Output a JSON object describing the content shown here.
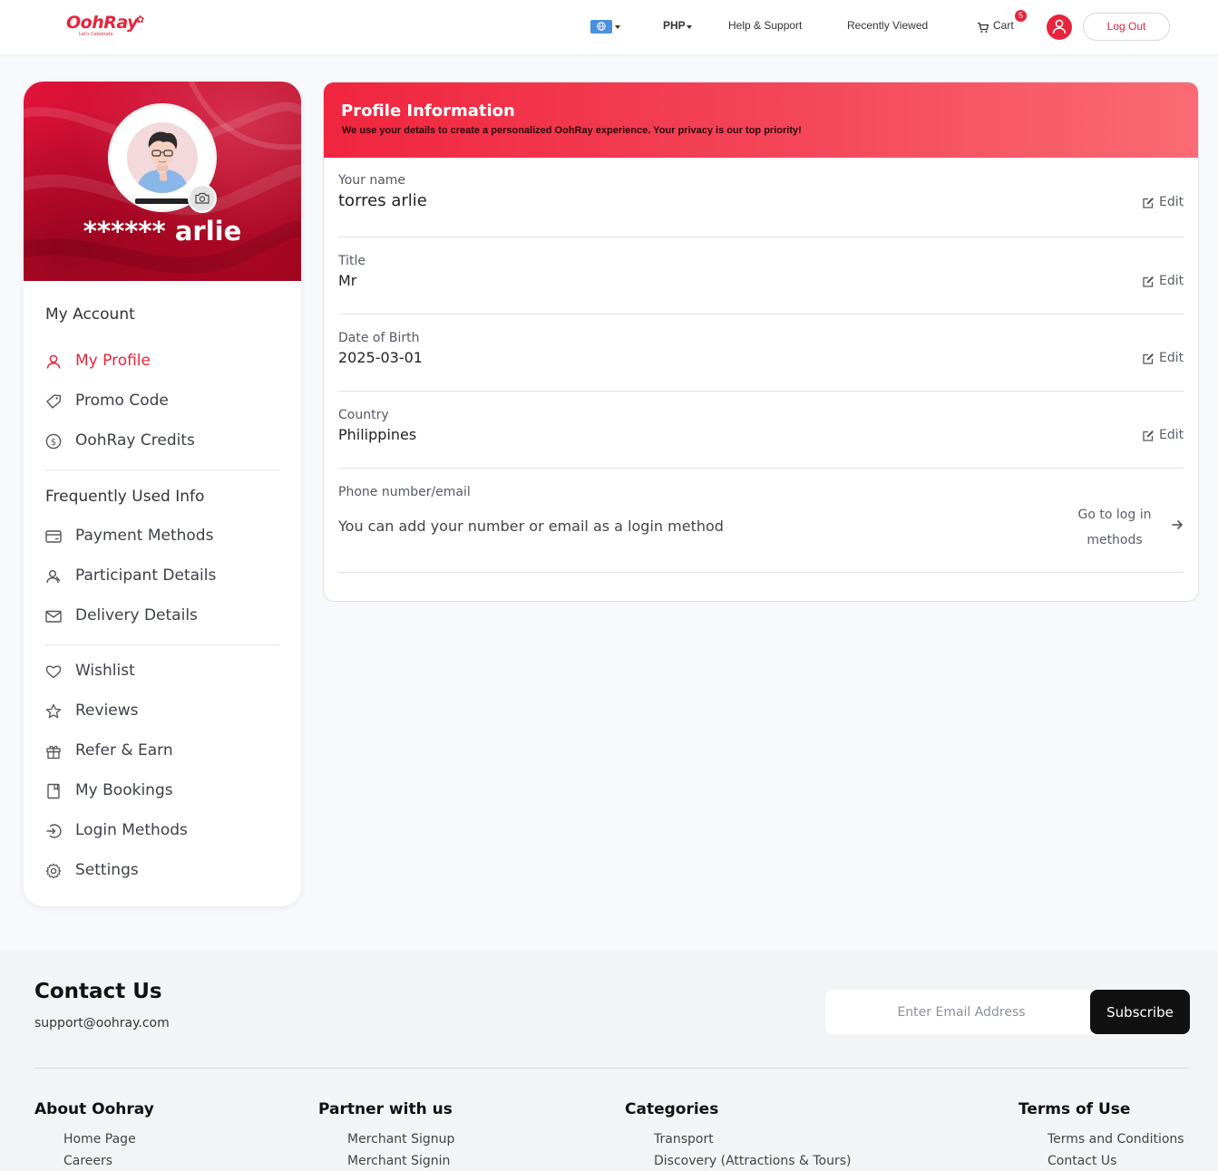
{
  "header": {
    "logo_text": "OohRay",
    "logo_tagline": "Let's Celebrate",
    "currency": "PHP",
    "help": "Help & Support",
    "recently_viewed": "Recently Viewed",
    "cart": "Cart",
    "cart_count": "5",
    "logout": "Log Out",
    "accent_color": "#e7243b"
  },
  "sidebar": {
    "user_display_name": "****** arlie",
    "sections": [
      {
        "heading": "My Account"
      },
      {
        "heading": "Frequently Used Info"
      }
    ],
    "account_items": [
      {
        "label": "My Profile",
        "icon": "user-icon",
        "active": true
      },
      {
        "label": "Promo Code",
        "icon": "tag-icon"
      },
      {
        "label": "OohRay Credits",
        "icon": "dollar-circle-icon"
      }
    ],
    "info_items": [
      {
        "label": "Payment Methods",
        "icon": "credit-card-icon"
      },
      {
        "label": "Participant Details",
        "icon": "users-icon"
      },
      {
        "label": "Delivery Details",
        "icon": "mail-icon"
      }
    ],
    "other_items": [
      {
        "label": "Wishlist",
        "icon": "heart-icon"
      },
      {
        "label": "Reviews",
        "icon": "star-icon"
      },
      {
        "label": "Refer & Earn",
        "icon": "gift-icon"
      },
      {
        "label": "My Bookings",
        "icon": "bookmark-icon"
      },
      {
        "label": "Login Methods",
        "icon": "login-icon"
      },
      {
        "label": "Settings",
        "icon": "gear-icon"
      }
    ]
  },
  "profile": {
    "title": "Profile Information",
    "subtitle": "We use your details to create a personalized OohRay experience. Your privacy is our top priority!",
    "edit_label": "Edit",
    "fields": [
      {
        "label": "Your name",
        "value": "torres arlie"
      },
      {
        "label": "Title",
        "value": "Mr"
      },
      {
        "label": "Date of Birth",
        "value": "2025-03-01"
      },
      {
        "label": "Country",
        "value": "Philippines"
      }
    ],
    "contact": {
      "label": "Phone number/email",
      "value": "You can add your number or email as a login method",
      "link_line1": "Go to log in",
      "link_line2": "methods"
    }
  },
  "footer": {
    "contact_title": "Contact Us",
    "contact_email": "support@oohray.com",
    "email_placeholder": "Enter Email Address",
    "subscribe": "Subscribe",
    "columns": [
      {
        "title": "About Oohray",
        "links": [
          "Home Page",
          "Careers"
        ]
      },
      {
        "title": "Partner with us",
        "links": [
          "Merchant Signup",
          "Merchant Signin"
        ]
      },
      {
        "title": "Categories",
        "links": [
          "Transport",
          "Discovery (Attractions & Tours)"
        ]
      },
      {
        "title": "Terms of Use",
        "links": [
          "Terms and Conditions",
          "Contact Us"
        ]
      }
    ]
  }
}
